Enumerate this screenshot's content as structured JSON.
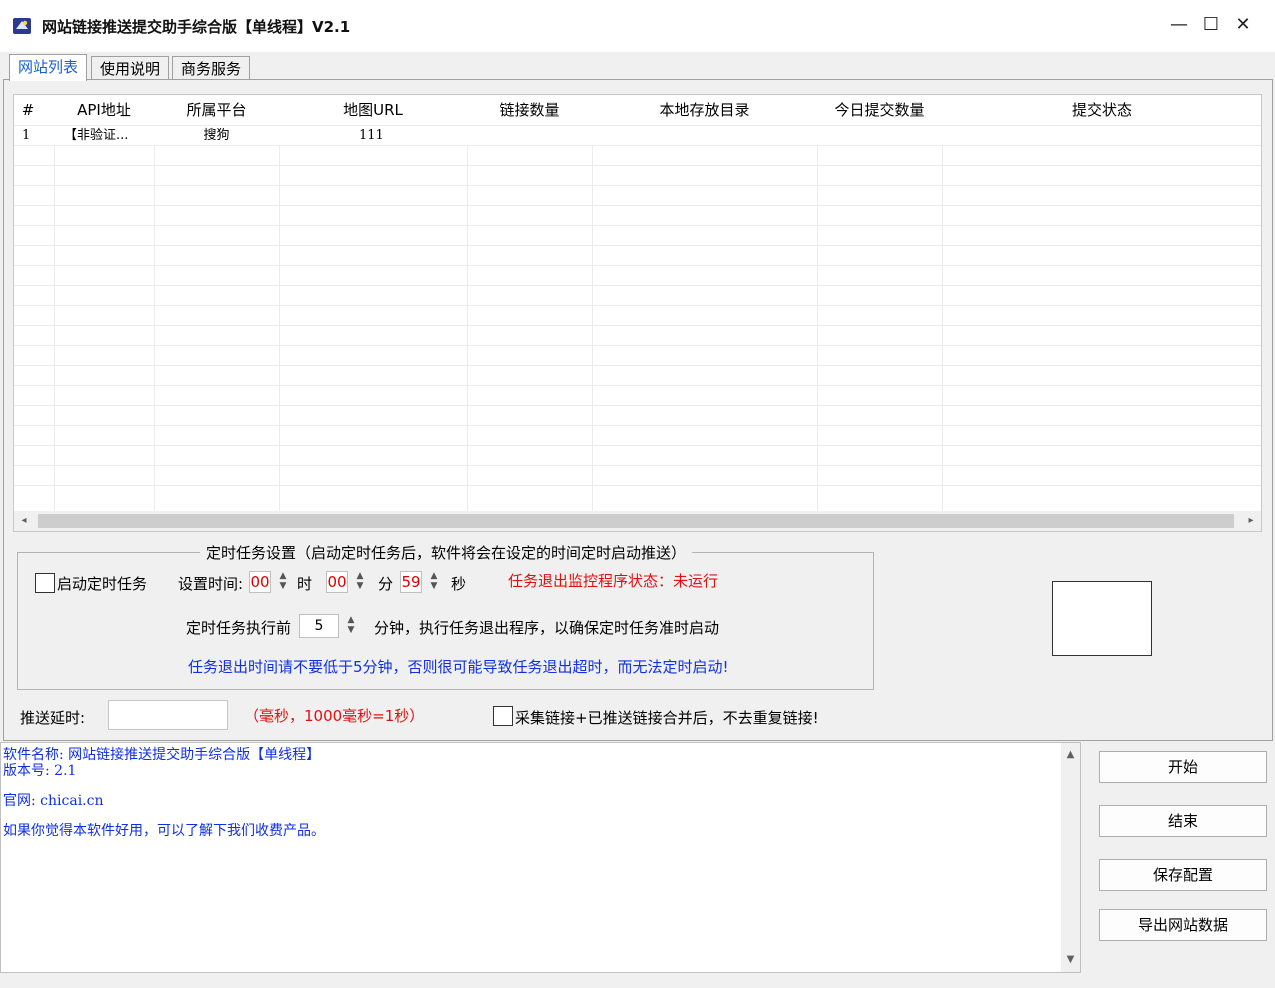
{
  "window": {
    "title": "网站链接推送提交助手综合版【单线程】V2.1",
    "minimize": "—",
    "maximize": "☐",
    "close": "✕"
  },
  "tabs": [
    {
      "label": "网站列表",
      "active": true
    },
    {
      "label": "使用说明",
      "active": false
    },
    {
      "label": "商务服务",
      "active": false
    }
  ],
  "grid": {
    "columns": [
      "#",
      "API地址",
      "所属平台",
      "地图URL",
      "链接数量",
      "本地存放目录",
      "今日提交数量",
      "提交状态"
    ],
    "rows": [
      [
        "1",
        "【非验证...",
        "搜狗",
        "111",
        "",
        "",
        "",
        ""
      ]
    ]
  },
  "schedule": {
    "group_title": "定时任务设置（启动定时任务后，软件将会在设定的时间定时启动推送）",
    "enable_label": "启动定时任务",
    "enabled": false,
    "set_time_label": "设置时间:",
    "hour": "00",
    "hour_unit": "时",
    "minute": "00",
    "minute_unit": "分",
    "second": "59",
    "second_unit": "秒",
    "monitor_status": "任务退出监控程序状态：未运行",
    "before_label": "定时任务执行前",
    "before_value": "5",
    "before_suffix": "分钟，执行任务退出程序，以确保定时任务准时启动",
    "warning": "任务退出时间请不要低于5分钟，否则很可能导致任务退出超时，而无法定时启动!"
  },
  "delay": {
    "label": "推送延时:",
    "value": "",
    "hint": "（毫秒，1000毫秒=1秒）"
  },
  "merge": {
    "label": "采集链接+已推送链接合并后，不去重复链接!",
    "checked": false
  },
  "log": {
    "lines": [
      "软件名称: 网站链接推送提交助手综合版【单线程】",
      "版本号: 2.1",
      "官网: chicai.cn",
      "如果你觉得本软件好用，可以了解下我们收费产品。"
    ]
  },
  "buttons": {
    "start": "开始",
    "stop": "结束",
    "save": "保存配置",
    "export": "导出网站数据"
  },
  "icons": {
    "app": "app-logo-icon",
    "spin": "spin-updown-icon",
    "scroll_left": "◂",
    "scroll_right": "▸",
    "scroll_up": "▲",
    "scroll_down": "▼"
  }
}
